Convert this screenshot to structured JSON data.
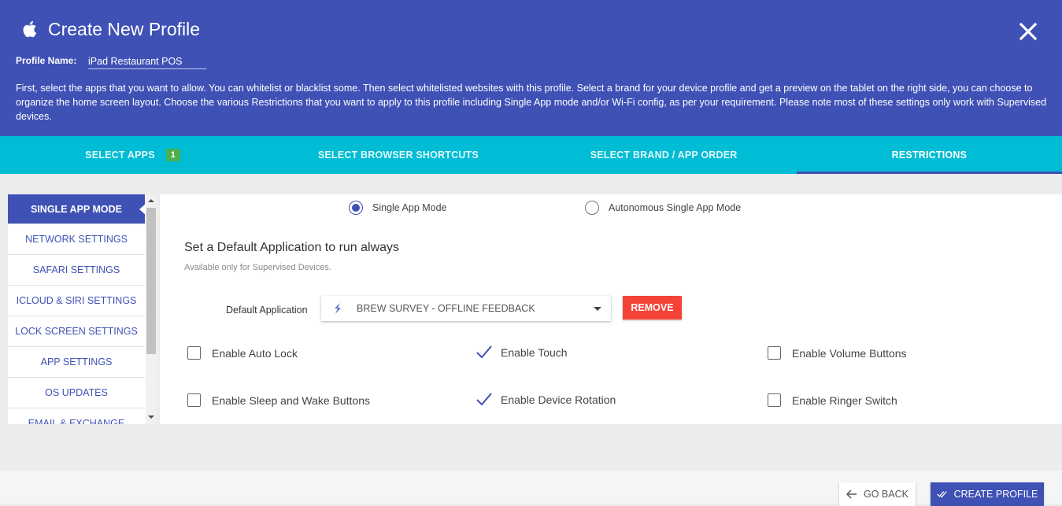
{
  "header": {
    "icon": "apple-icon",
    "title": "Create New Profile",
    "profile_name_label": "Profile Name:",
    "profile_name_value": "iPad Restaurant POS",
    "description": "First, select the apps that you want to allow. You can whitelist or blacklist some. Then select whitelisted websites with this profile. Select a brand for your device profile and get a preview on the tablet on the right side, you can choose to organize the home screen layout. Choose the various Restrictions that you want to apply to this profile including Single App mode and/or Wi-Fi config, as per your requirement. Please note most of these settings only work with Supervised devices."
  },
  "tabs": [
    {
      "label": "SELECT APPS",
      "badge": "1"
    },
    {
      "label": "SELECT BROWSER SHORTCUTS"
    },
    {
      "label": "SELECT BRAND / APP ORDER"
    },
    {
      "label": "RESTRICTIONS",
      "active": true
    }
  ],
  "sidebar": {
    "items": [
      {
        "label": "SINGLE APP MODE",
        "active": true
      },
      {
        "label": "NETWORK SETTINGS"
      },
      {
        "label": "SAFARI SETTINGS"
      },
      {
        "label": "ICLOUD & SIRI SETTINGS"
      },
      {
        "label": "LOCK SCREEN SETTINGS"
      },
      {
        "label": "APP SETTINGS"
      },
      {
        "label": "OS UPDATES"
      },
      {
        "label": "EMAIL & EXCHANGE"
      }
    ]
  },
  "main": {
    "modes": [
      {
        "label": "Single App Mode",
        "selected": true
      },
      {
        "label": "Autonomous Single App Mode",
        "selected": false
      }
    ],
    "section_title": "Set a Default Application to run always",
    "section_subtitle": "Available only for Supervised Devices.",
    "default_app_label": "Default Application",
    "default_app_value": "BREW SURVEY - OFFLINE FEEDBACK",
    "remove_label": "REMOVE",
    "options": [
      {
        "label": "Enable Auto Lock",
        "checked": false
      },
      {
        "label": "Enable Touch",
        "checked": true
      },
      {
        "label": "Enable Volume Buttons",
        "checked": false
      },
      {
        "label": "Enable Sleep and Wake Buttons",
        "checked": false
      },
      {
        "label": "Enable Device Rotation",
        "checked": true
      },
      {
        "label": "Enable Ringer Switch",
        "checked": false
      }
    ]
  },
  "footer": {
    "back_label": "GO BACK",
    "create_label": "CREATE PROFILE"
  },
  "colors": {
    "primary": "#3f51b5",
    "tab_bar": "#00bcd4",
    "danger": "#f44336",
    "badge": "#4caf50"
  }
}
